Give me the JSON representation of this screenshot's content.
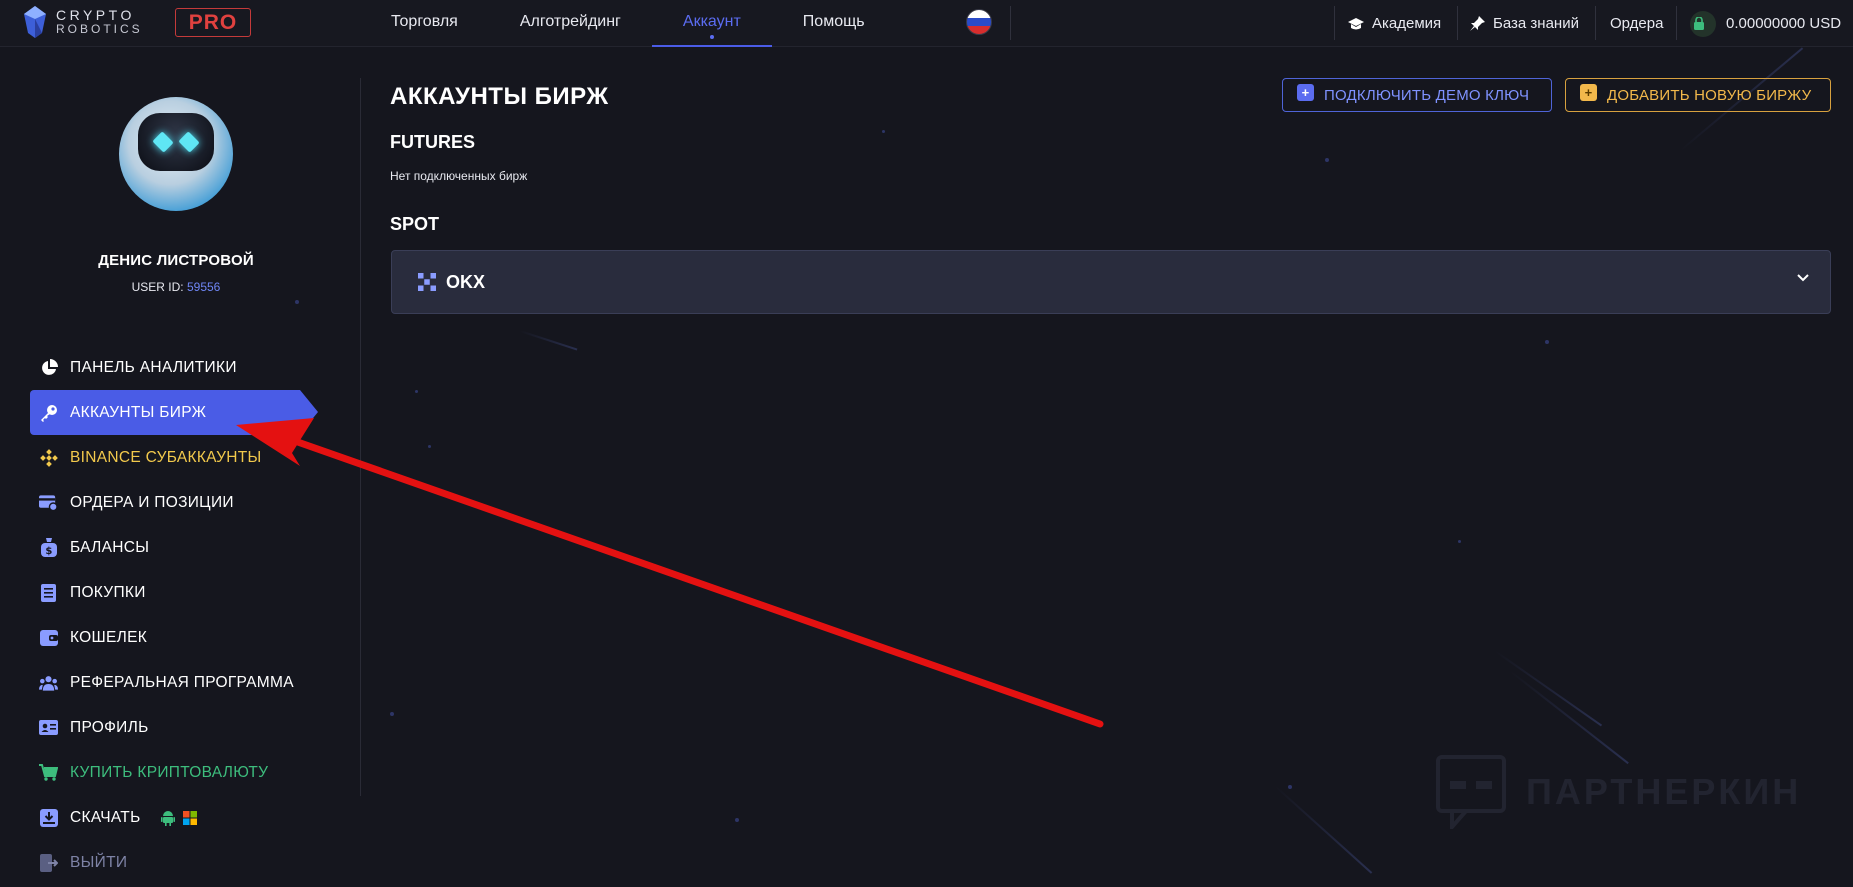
{
  "header": {
    "logo_line1": "CRYPTO",
    "logo_line2": "ROBOTICS",
    "pro_badge": "PRO",
    "nav": [
      {
        "label": "Торговля",
        "active": false
      },
      {
        "label": "Алготрейдинг",
        "active": false
      },
      {
        "label": "Аккаунт",
        "active": true
      },
      {
        "label": "Помощь",
        "active": false
      }
    ],
    "language_flag": "ru-flag-icon",
    "academy_label": "Академия",
    "knowledge_label": "База знаний",
    "orders_label": "Ордера",
    "balance": "0.00000000 USD"
  },
  "sidebar": {
    "user_name": "ДЕНИС ЛИСТРОВОЙ",
    "user_id_label": "USER ID:",
    "user_id_value": "59556",
    "items": [
      {
        "label": "ПАНЕЛЬ АНАЛИТИКИ",
        "icon": "pie-chart-icon"
      },
      {
        "label": "АККАУНТЫ БИРЖ",
        "icon": "key-icon",
        "active": true
      },
      {
        "label": "BINANCE СУБАККАУНТЫ",
        "icon": "binance-icon"
      },
      {
        "label": "ОРДЕРА И ПОЗИЦИИ",
        "icon": "orders-icon"
      },
      {
        "label": "БАЛАНСЫ",
        "icon": "money-bag-icon"
      },
      {
        "label": "ПОКУПКИ",
        "icon": "receipt-icon"
      },
      {
        "label": "КОШЕЛЕК",
        "icon": "wallet-icon"
      },
      {
        "label": "РЕФЕРАЛЬНАЯ ПРОГРАММА",
        "icon": "users-icon"
      },
      {
        "label": "ПРОФИЛЬ",
        "icon": "id-card-icon"
      },
      {
        "label": "КУПИТЬ КРИПТОВАЛЮТУ",
        "icon": "cart-icon"
      },
      {
        "label": "СКАЧАТЬ",
        "icon": "download-icon"
      },
      {
        "label": "ВЫЙТИ",
        "icon": "logout-icon"
      }
    ]
  },
  "main": {
    "title": "АККАУНТЫ БИРЖ",
    "demo_button": "ПОДКЛЮЧИТЬ ДЕМО КЛЮЧ",
    "add_button": "ДОБАВИТЬ НОВУЮ БИРЖУ",
    "futures_heading": "FUTURES",
    "futures_note": "Нет подключенных бирж",
    "spot_heading": "SPOT",
    "spot_exchange": "OKX"
  },
  "watermark": "ПАРТНЕРКИН",
  "colors": {
    "accent": "#4a5ce6",
    "warning": "#f2b84b",
    "success": "#3dbd7d",
    "danger": "#e0413f",
    "background": "#15161e"
  }
}
